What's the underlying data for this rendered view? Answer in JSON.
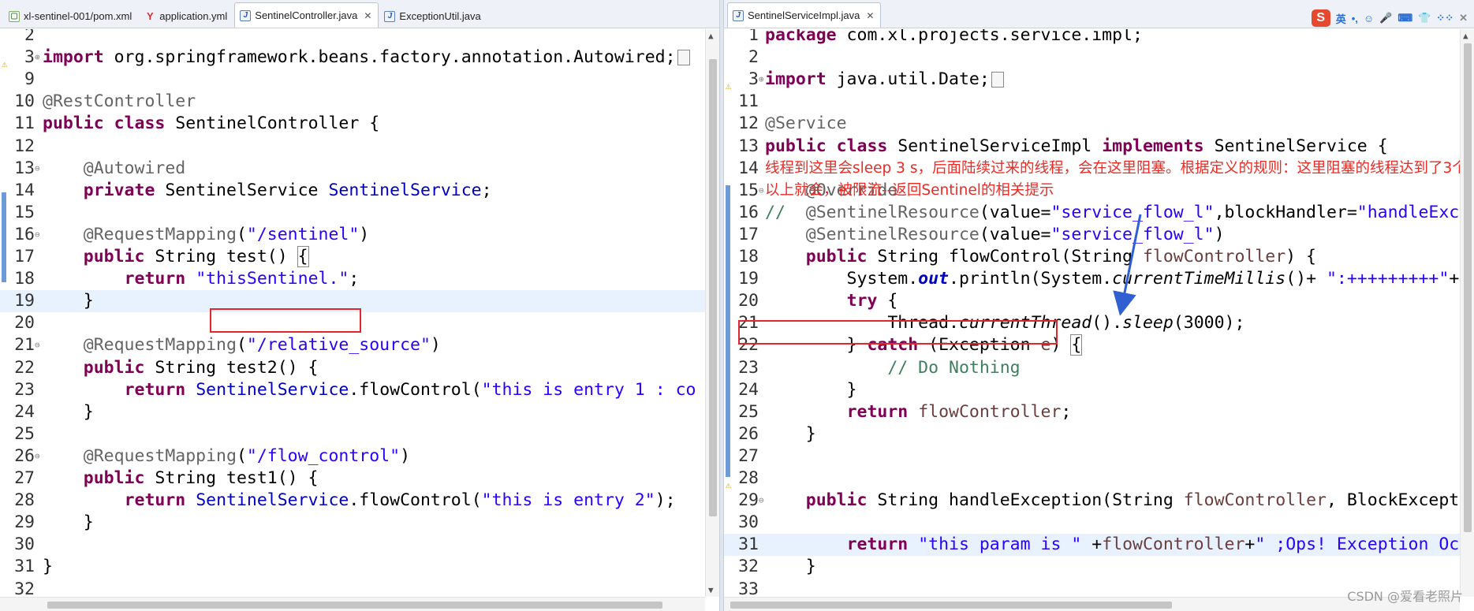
{
  "left": {
    "tabs": [
      {
        "label": "xl-sentinel-001/pom.xml",
        "icon": "xml-file-icon"
      },
      {
        "label": "application.yml",
        "icon": "yml-file-icon"
      },
      {
        "label": "SentinelController.java",
        "icon": "java-file-icon",
        "active": true,
        "close": "✕"
      },
      {
        "label": "ExceptionUtil.java",
        "icon": "java-file-icon"
      }
    ],
    "lines": [
      {
        "n": "2",
        "code": ""
      },
      {
        "n": "3",
        "fold": "⊕",
        "code": "<span class='kw'>import</span> org.springframework.beans.factory.annotation.Autowired;<span class='boxsq'></span>"
      },
      {
        "n": "9",
        "code": ""
      },
      {
        "n": "10",
        "code": "<span class='ann'>@RestController</span>"
      },
      {
        "n": "11",
        "code": "<span class='kw'>public</span> <span class='kw'>class</span> SentinelController {"
      },
      {
        "n": "12",
        "code": ""
      },
      {
        "n": "13",
        "fold": "⊖",
        "code": "    <span class='ann'>@Autowired</span>"
      },
      {
        "n": "14",
        "code": "    <span class='kw'>private</span> SentinelService <span class='fld'>SentinelService</span>;"
      },
      {
        "n": "15",
        "code": ""
      },
      {
        "n": "16",
        "fold": "⊖",
        "code": "    <span class='ann'>@RequestMapping</span>(<span class='str'>\"/sentinel\"</span>)"
      },
      {
        "n": "17",
        "code": "    <span class='kw'>public</span> String test() <span class='brace-hl'>{</span>"
      },
      {
        "n": "18",
        "code": "        <span class='kw'>return</span> <span class='str'>\"thisSentinel.\"</span>;"
      },
      {
        "n": "19",
        "code": "    }"
      },
      {
        "n": "20",
        "code": ""
      },
      {
        "n": "21",
        "fold": "⊖",
        "code": "    <span class='ann'>@RequestMapping</span>(<span class='str'>\"/relative_source\"</span>)"
      },
      {
        "n": "22",
        "code": "    <span class='kw'>public</span> String test2() {"
      },
      {
        "n": "23",
        "code": "        <span class='kw'>return</span> <span class='fld'>SentinelService</span>.flowControl(<span class='str'>\"this is entry 1 : co</span>"
      },
      {
        "n": "24",
        "code": "    }"
      },
      {
        "n": "25",
        "code": ""
      },
      {
        "n": "26",
        "fold": "⊖",
        "code": "    <span class='ann'>@RequestMapping</span>(<span class='str'>\"/flow_control\"</span>)"
      },
      {
        "n": "27",
        "code": "    <span class='kw'>public</span> String test1() {"
      },
      {
        "n": "28",
        "code": "        <span class='kw'>return</span> <span class='fld'>SentinelService</span>.flowControl(<span class='str'>\"this is entry 2\"</span>);"
      },
      {
        "n": "29",
        "code": "    }"
      },
      {
        "n": "30",
        "code": ""
      },
      {
        "n": "31",
        "code": "}"
      },
      {
        "n": "32",
        "code": ""
      }
    ]
  },
  "right": {
    "tabs": [
      {
        "label": "SentinelServiceImpl.java",
        "icon": "java-file-icon",
        "active": true,
        "close": "✕"
      }
    ],
    "ime": {
      "logo": "S",
      "items": [
        "英",
        "•,",
        "☺",
        "🎤",
        "⌨",
        "👕",
        "⁘⁘"
      ],
      "close": "✕"
    },
    "lines": [
      {
        "n": "1",
        "code": "<span class='kw'>package</span> com.xl.projects.service.impl;"
      },
      {
        "n": "2",
        "code": ""
      },
      {
        "n": "3",
        "fold": "⊕",
        "code": "<span class='kw'>import</span> java.util.Date;<span class='boxsq'></span>"
      },
      {
        "n": "11",
        "code": ""
      },
      {
        "n": "12",
        "code": "<span class='ann'>@Service</span>"
      },
      {
        "n": "13",
        "code": "<span class='kw'>public</span> <span class='kw'>class</span> SentinelServiceImpl <span class='kw'>implements</span> SentinelService {"
      },
      {
        "n": "14",
        "code": ""
      },
      {
        "n": "15",
        "fold": "⊖",
        "code": "    <span class='ann'>@Override</span>"
      },
      {
        "n": "16",
        "code": "<span class='cm'>//</span>  <span class='ann'>@SentinelResource</span>(value=<span class='str'>\"service_flow_l\"</span>,blockHandler=<span class='str'>\"handleExc</span>"
      },
      {
        "n": "17",
        "code": "    <span class='ann'>@SentinelResource</span>(value=<span class='str'>\"service_flow_l\"</span>)"
      },
      {
        "n": "18",
        "code": "    <span class='kw'>public</span> String flowControl(String <span class='prm'>flowController</span>) {"
      },
      {
        "n": "19",
        "code": "        System.<span class='st'>out</span>.println(System.<span class='it'>currentTimeMillis</span>()+ <span class='str'>\":+++++++++\"</span>+"
      },
      {
        "n": "20",
        "code": "        <span class='kw'>try</span> {"
      },
      {
        "n": "21",
        "code": "            Thread.<span class='it'>currentThread</span>().<span class='it'>sleep</span>(3000);"
      },
      {
        "n": "22",
        "code": "        } <span class='kw'>catch</span> (Exception <span class='prm'>e</span>) <span class='brace-hl'>{</span>"
      },
      {
        "n": "23",
        "code": "            <span class='cm'>// Do Nothing</span>"
      },
      {
        "n": "24",
        "code": "        }"
      },
      {
        "n": "25",
        "code": "        <span class='kw'>return</span> <span class='prm'>flowController</span>;"
      },
      {
        "n": "26",
        "code": "    }"
      },
      {
        "n": "27",
        "code": ""
      },
      {
        "n": "28",
        "code": ""
      },
      {
        "n": "29",
        "fold": "⊖",
        "code": "    <span class='kw'>public</span> String handleException(String <span class='prm'>flowController</span>, BlockExcept"
      },
      {
        "n": "30",
        "code": ""
      },
      {
        "n": "31",
        "code": "        <span class='kw'>return</span> <span class='str'>\"this param is \"</span> +<span class='prm'>flowController</span>+<span class='str'>\" ;Ops! Exception Oc</span>"
      },
      {
        "n": "32",
        "code": "    }"
      },
      {
        "n": "33",
        "code": ""
      }
    ],
    "callout": "线程到这里会sleep 3 s，后面陆续过来的线程，会在这里阻塞。根据定义的规则：这里阻塞的线程达到了3个以上就会，被限流--返回Sentinel的相关提示"
  },
  "watermark": "CSDN @爱看老照片",
  "colors": {
    "keyword": "#7f0055",
    "string": "#2a00ff",
    "annotation": "#646464",
    "comment": "#3f7f5f",
    "highlight_box": "#e2262b",
    "callout_text": "#ee2a24",
    "arrow": "#2f5fd0"
  }
}
